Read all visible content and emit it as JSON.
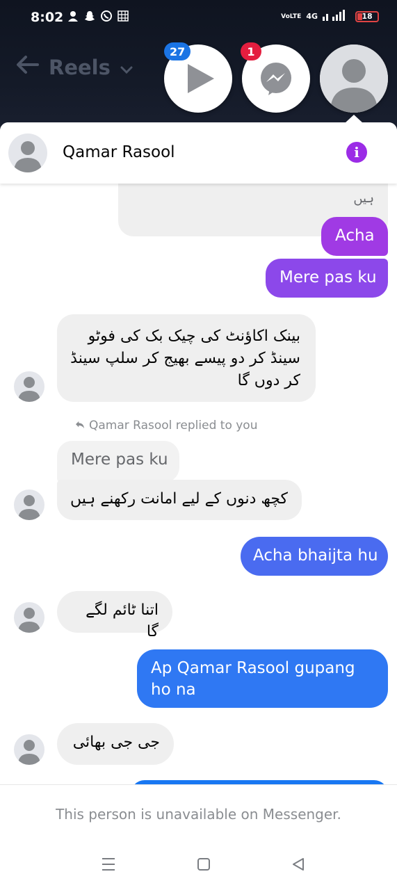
{
  "status_bar": {
    "time": "8:02",
    "network_label": "4G",
    "volte_label": "VoLTE",
    "battery_level": "18",
    "battery_color": "#e04444"
  },
  "background_app": {
    "back_icon": "arrow-left-icon",
    "title": "Reels",
    "chevron_icon": "chevron-down-icon"
  },
  "chat_heads": [
    {
      "name": "video-chat-head",
      "icon": "play-icon",
      "badge": "27",
      "badge_color": "#1b74e4"
    },
    {
      "name": "messenger-chat-head",
      "icon": "messenger-icon",
      "badge": "1",
      "badge_color": "#e41e3f"
    },
    {
      "name": "contact-chat-head",
      "icon": "avatar-icon"
    }
  ],
  "conversation": {
    "contact_name": "Qamar Rasool",
    "info_icon_label": "i",
    "accent_color": "#9b2ce6",
    "messages": [
      {
        "from": "them",
        "text": "ہیں"
      },
      {
        "from": "me",
        "text": "Acha"
      },
      {
        "from": "me",
        "text": "Mere pas ku"
      },
      {
        "from": "them",
        "text": "بینک اکاؤنٹ کی چیک بک کی فوٹو سینڈ کر دو پیسے بھیج کر سلپ سینڈ کر دوں گا"
      },
      {
        "from": "meta",
        "text": "Qamar Rasool replied to you"
      },
      {
        "from": "quote",
        "text": "Mere pas ku"
      },
      {
        "from": "them",
        "text": "کچھ دنوں کے لیے امانت رکھنے ہیں"
      },
      {
        "from": "me",
        "text": "Acha bhaijta hu"
      },
      {
        "from": "them",
        "text": "اتنا ٹائم لگے گا"
      },
      {
        "from": "me",
        "text": "Ap Qamar Rasool gupang ho na"
      },
      {
        "from": "them",
        "text": "جی جی بھائی"
      }
    ]
  },
  "footer": {
    "notice": "This person is unavailable on Messenger."
  },
  "nav_bar": {
    "buttons": [
      "menu-icon",
      "home-icon",
      "back-icon"
    ]
  }
}
